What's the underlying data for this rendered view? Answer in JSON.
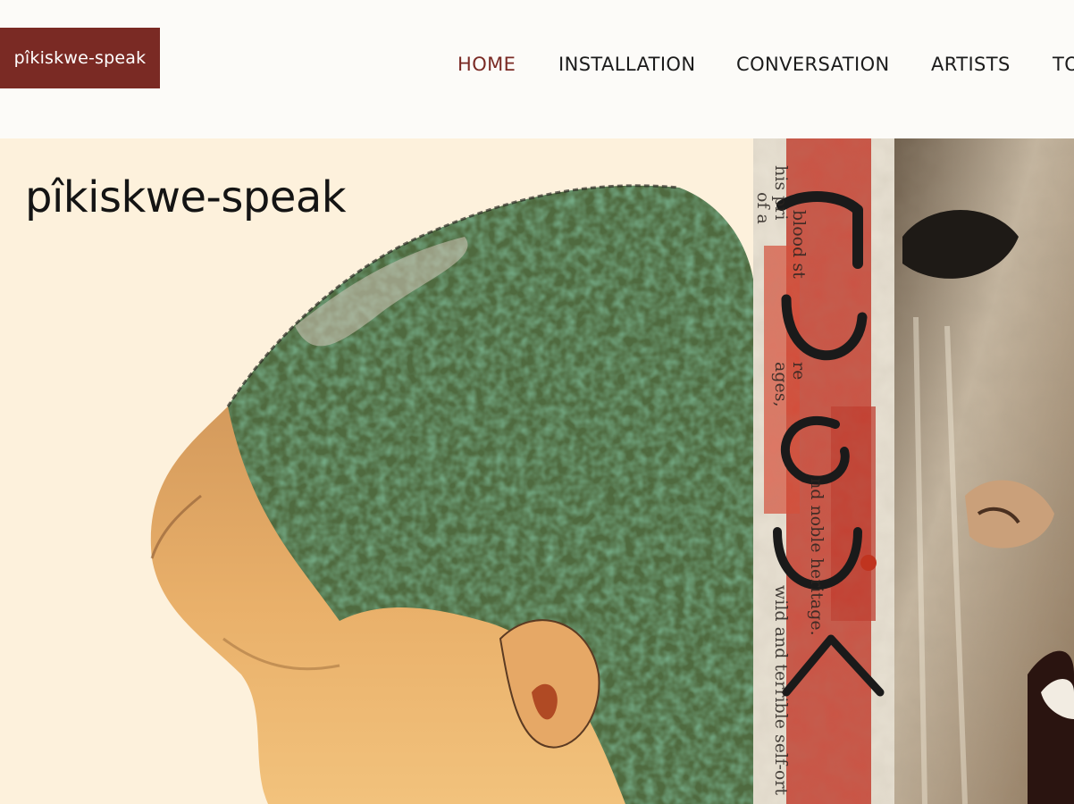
{
  "site": {
    "logo_label": "pîkiskwe-speak"
  },
  "nav": {
    "items": [
      {
        "label": "HOME",
        "active": true
      },
      {
        "label": "INSTALLATION",
        "active": false
      },
      {
        "label": "CONVERSATION",
        "active": false
      },
      {
        "label": "ARTISTS",
        "active": false
      },
      {
        "label": "TO",
        "active": false
      }
    ]
  },
  "hero": {
    "title": "pîkiskwe-speak",
    "collage_text": [
      "his pri",
      "blood st",
      "ages,",
      "re",
      "nd noble heritage.",
      "wild and terrible self-ort",
      "of a"
    ]
  },
  "colors": {
    "accent": "#7a2a24",
    "hero_bg": "#fdf1dc",
    "header_bg": "#fcfbf8"
  }
}
